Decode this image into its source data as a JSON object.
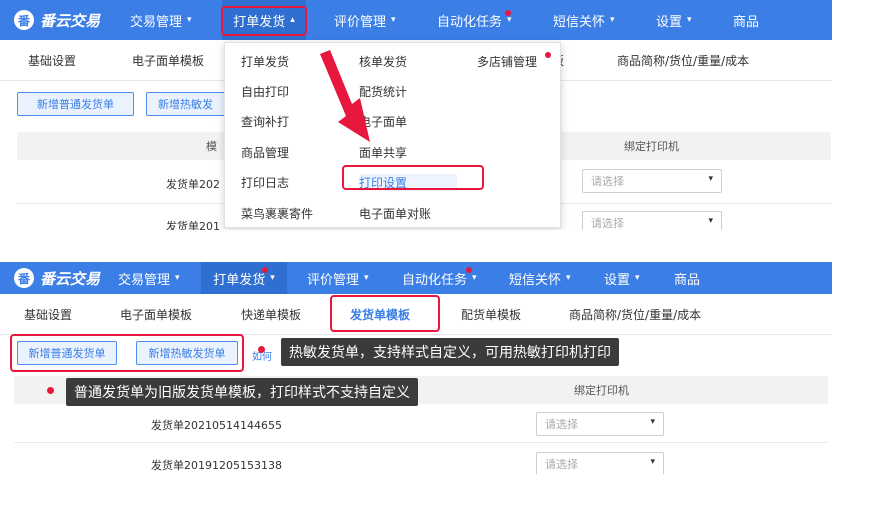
{
  "brand": {
    "name": "番云交易",
    "mark": "番"
  },
  "top_nav": [
    {
      "label": "交易管理"
    },
    {
      "label": "打单发货"
    },
    {
      "label": "评价管理"
    },
    {
      "label": "自动化任务"
    },
    {
      "label": "短信关怀"
    },
    {
      "label": "设置"
    },
    {
      "label": "商品"
    }
  ],
  "caret_down": "▾",
  "caret_up": "▴",
  "dropdown": {
    "col1": [
      "打单发货",
      "自由打印",
      "查询补打",
      "商品管理",
      "打印日志",
      "菜鸟裹裹寄件"
    ],
    "col2": [
      "核单发货",
      "配货统计",
      "电子面单",
      "面单共享",
      "打印设置",
      "电子面单对账"
    ],
    "col3": [
      "多店铺管理"
    ]
  },
  "panel1": {
    "subnav": [
      "基础设置",
      "电子面单模板",
      "板",
      "商品简称/货位/重量/成本"
    ],
    "buttons": [
      "新增普通发货单",
      "新增热敏发"
    ],
    "headers": [
      "模",
      "绑定打印机"
    ],
    "rows": [
      {
        "name": "发货单202",
        "printer": "请选择"
      },
      {
        "name": "发货单201",
        "printer": "请选择"
      }
    ]
  },
  "panel2": {
    "subnav": [
      "基础设置",
      "电子面单模板",
      "快递单模板",
      "发货单模板",
      "配货单模板",
      "商品简称/货位/重量/成本"
    ],
    "buttons": [
      "新增普通发货单",
      "新增热敏发货单"
    ],
    "link": "如何",
    "headers": [
      "绑定打印机"
    ],
    "rows": [
      {
        "name": "发货单20210514144655",
        "printer": "请选择"
      },
      {
        "name": "发货单20191205153138",
        "printer": "请选择"
      }
    ]
  },
  "tooltips": {
    "thermal": "热敏发货单，支持样式自定义，可用热敏打印机打印",
    "normal": "普通发货单为旧版发货单模板，打印样式不支持自定义"
  },
  "colors": {
    "nav_bg": "#3a7ee6",
    "highlight": "#e8173d",
    "button_border": "#4c8ef0"
  }
}
